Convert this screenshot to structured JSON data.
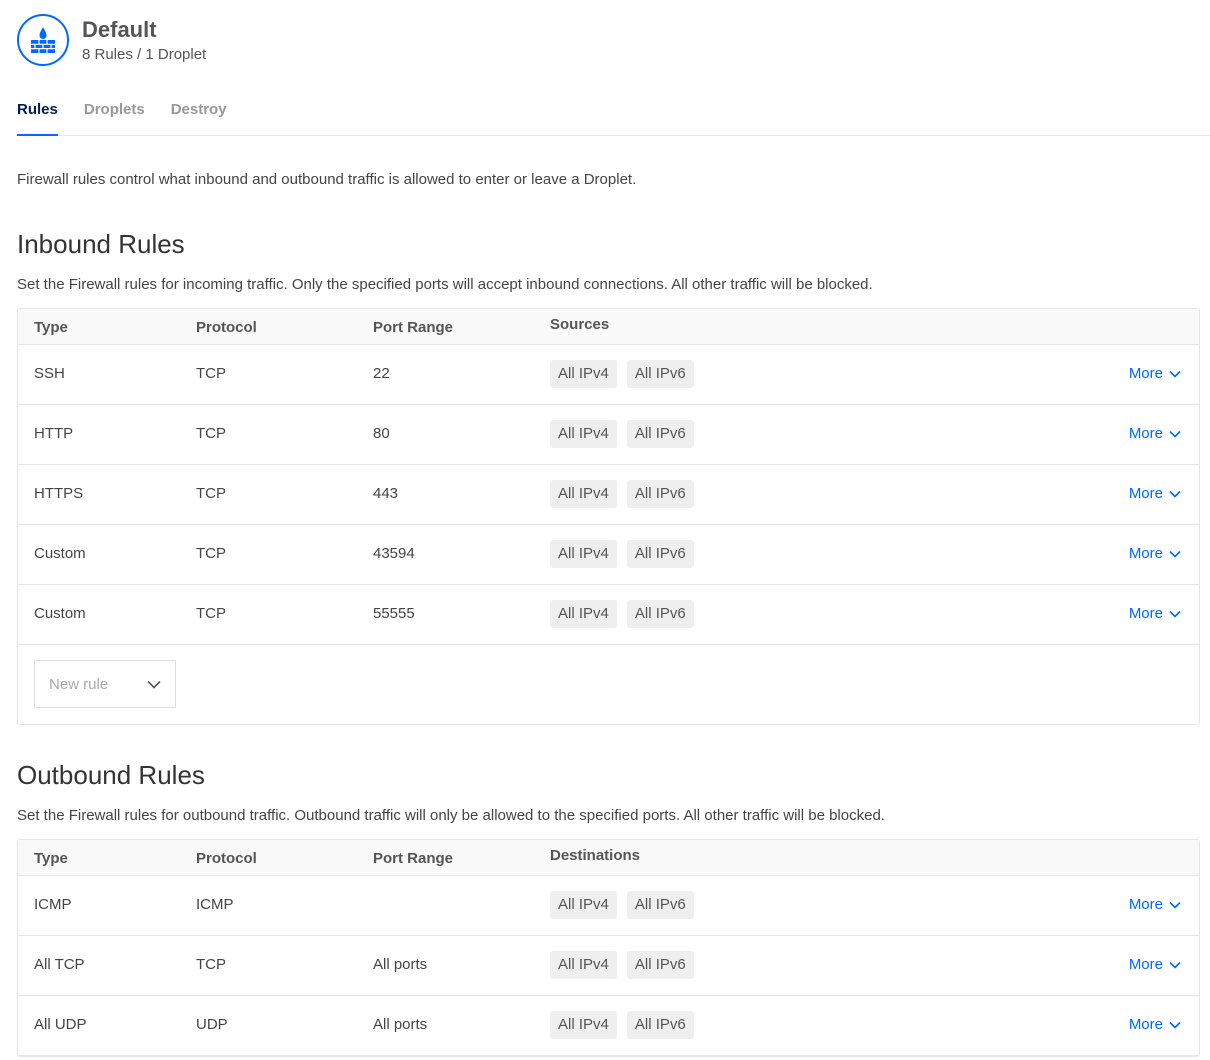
{
  "header": {
    "title": "Default",
    "subtitle": "8 Rules / 1 Droplet",
    "icon": "firewall-icon",
    "accent_color": "#0069ff"
  },
  "tabs": [
    {
      "label": "Rules",
      "active": true
    },
    {
      "label": "Droplets",
      "active": false
    },
    {
      "label": "Destroy",
      "active": false
    }
  ],
  "intro": "Firewall rules control what inbound and outbound traffic is allowed to enter or leave a Droplet.",
  "inbound": {
    "title": "Inbound Rules",
    "description": "Set the Firewall rules for incoming traffic. Only the specified ports will accept inbound connections. All other traffic will be blocked.",
    "columns": [
      "Type",
      "Protocol",
      "Port Range",
      "Sources"
    ],
    "rows": [
      {
        "type": "SSH",
        "protocol": "TCP",
        "port": "22",
        "tags": [
          "All IPv4",
          "All IPv6"
        ],
        "more": "More"
      },
      {
        "type": "HTTP",
        "protocol": "TCP",
        "port": "80",
        "tags": [
          "All IPv4",
          "All IPv6"
        ],
        "more": "More"
      },
      {
        "type": "HTTPS",
        "protocol": "TCP",
        "port": "443",
        "tags": [
          "All IPv4",
          "All IPv6"
        ],
        "more": "More"
      },
      {
        "type": "Custom",
        "protocol": "TCP",
        "port": "43594",
        "tags": [
          "All IPv4",
          "All IPv6"
        ],
        "more": "More"
      },
      {
        "type": "Custom",
        "protocol": "TCP",
        "port": "55555",
        "tags": [
          "All IPv4",
          "All IPv6"
        ],
        "more": "More"
      }
    ],
    "new_rule_placeholder": "New rule"
  },
  "outbound": {
    "title": "Outbound Rules",
    "description": "Set the Firewall rules for outbound traffic. Outbound traffic will only be allowed to the specified ports. All other traffic will be blocked.",
    "columns": [
      "Type",
      "Protocol",
      "Port Range",
      "Destinations"
    ],
    "rows": [
      {
        "type": "ICMP",
        "protocol": "ICMP",
        "port": "",
        "tags": [
          "All IPv4",
          "All IPv6"
        ],
        "more": "More"
      },
      {
        "type": "All TCP",
        "protocol": "TCP",
        "port": "All ports",
        "tags": [
          "All IPv4",
          "All IPv6"
        ],
        "more": "More"
      },
      {
        "type": "All UDP",
        "protocol": "UDP",
        "port": "All ports",
        "tags": [
          "All IPv4",
          "All IPv6"
        ],
        "more": "More"
      }
    ]
  }
}
